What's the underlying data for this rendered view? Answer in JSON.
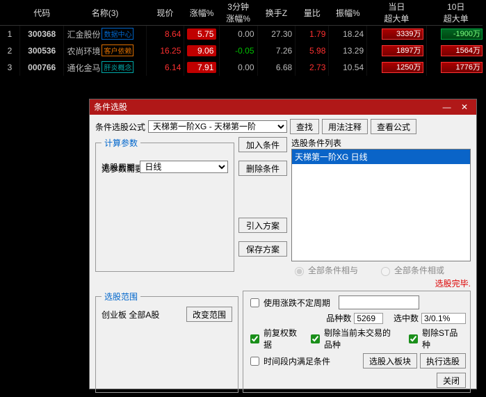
{
  "table": {
    "headers": [
      "",
      "代码",
      "名称(3)",
      "现价",
      "涨幅%",
      "3分钟涨幅%",
      "换手Z",
      "量比",
      "振幅%",
      "当日超大单",
      "10日超大单"
    ],
    "rows": [
      {
        "idx": "1",
        "code": "300368",
        "name": "汇金股份",
        "tag": "数据中心",
        "tagCls": "c0",
        "price": "8.64",
        "chg": "5.75",
        "m3": "0.00",
        "m3cls": "gry",
        "turn": "27.30",
        "volr": "1.79",
        "amp": "18.24",
        "d1": "3339万",
        "d1c": "r",
        "d10": "-1900万",
        "d10c": "g"
      },
      {
        "idx": "2",
        "code": "300536",
        "name": "农尚环境",
        "tag": "客户依赖",
        "tagCls": "c1",
        "price": "16.25",
        "chg": "9.06",
        "m3": "-0.05",
        "m3cls": "grn",
        "turn": "7.26",
        "volr": "5.98",
        "amp": "13.29",
        "d1": "1897万",
        "d1c": "r",
        "d10": "1564万",
        "d10c": "r"
      },
      {
        "idx": "3",
        "code": "000766",
        "name": "通化金马",
        "tag": "肝炎概念",
        "tagCls": "c2",
        "price": "6.14",
        "chg": "7.91",
        "m3": "0.00",
        "m3cls": "gry",
        "turn": "6.68",
        "volr": "2.73",
        "amp": "10.54",
        "d1": "1250万",
        "d1c": "r",
        "d10": "1776万",
        "d10c": "r"
      }
    ]
  },
  "dlg": {
    "title": "条件选股",
    "lblFormula": "条件选股公式",
    "formula": "天梯第一阶XG - 天梯第一阶",
    "btnSearch": "查找",
    "btnUsage": "用法注释",
    "btnView": "查看公式",
    "grpCalc": "计算参数",
    "calcMsg": "无参数需要设置",
    "lblCycle": "选股周期:",
    "cycle": "日线",
    "btnAdd": "加入条件",
    "btnDel": "删除条件",
    "btnImport": "引入方案",
    "btnSave": "保存方案",
    "lblList": "选股条件列表",
    "listItem": "天梯第一阶XG  日线",
    "radAnd": "全部条件相与",
    "radOr": "全部条件相或",
    "status": "选股完毕.",
    "grpScope": "选股范围",
    "scopeText": "创业板 全部A股",
    "btnScope": "改变范围",
    "chkNotFixed": "使用涨跌不定周期",
    "inputNF": "",
    "lblCount": "品种数",
    "count": "5269",
    "lblHit": "选中数",
    "hit": "3/0.1%",
    "chkFq": "前复权数据",
    "chkNoTrade": "剔除当前未交易的品种",
    "chkST": "剔除ST品种",
    "chkSpan": "时间段内满足条件",
    "btnToBlock": "选股入板块",
    "btnExec": "执行选股",
    "btnClose": "关闭"
  }
}
